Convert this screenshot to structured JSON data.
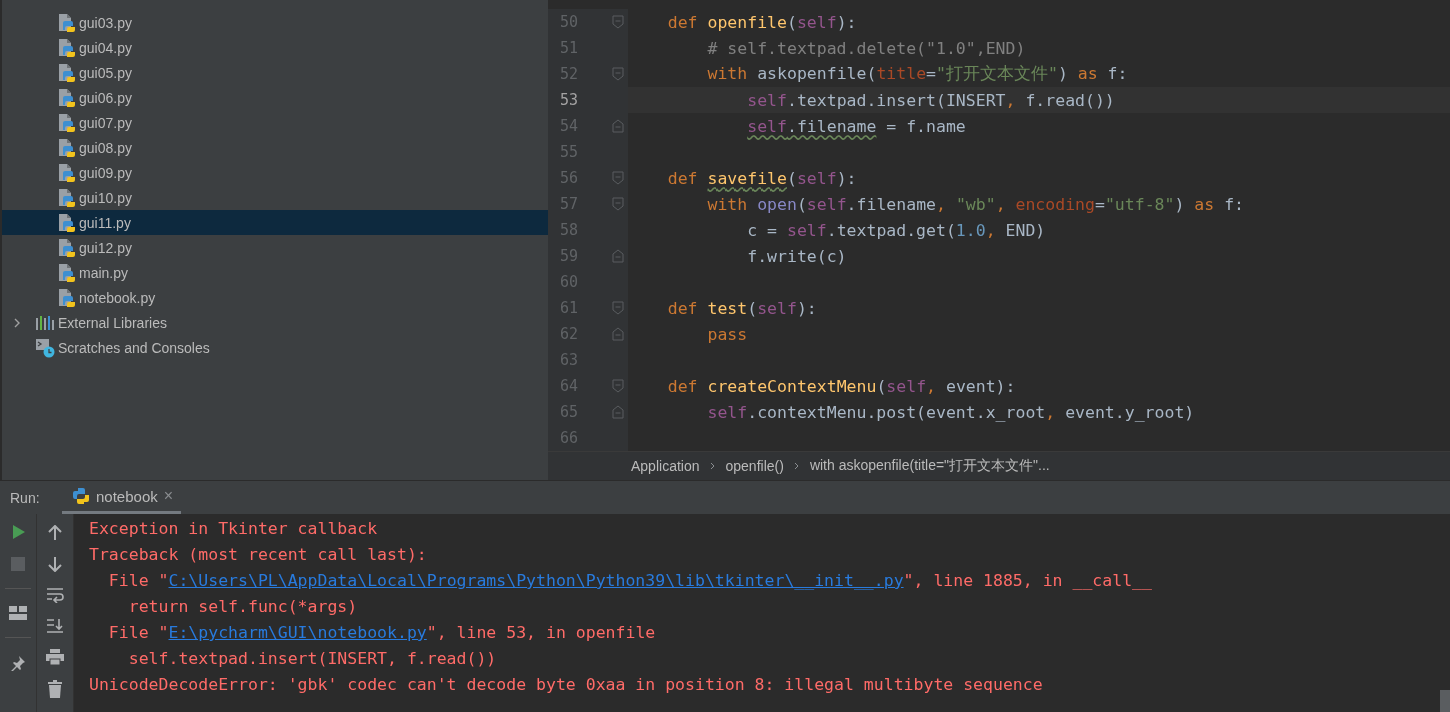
{
  "project_tree": {
    "items": [
      {
        "kind": "file",
        "label": "gui03.py",
        "selected": false
      },
      {
        "kind": "file",
        "label": "gui04.py",
        "selected": false
      },
      {
        "kind": "file",
        "label": "gui05.py",
        "selected": false
      },
      {
        "kind": "file",
        "label": "gui06.py",
        "selected": false
      },
      {
        "kind": "file",
        "label": "gui07.py",
        "selected": false
      },
      {
        "kind": "file",
        "label": "gui08.py",
        "selected": false
      },
      {
        "kind": "file",
        "label": "gui09.py",
        "selected": false
      },
      {
        "kind": "file",
        "label": "gui10.py",
        "selected": false
      },
      {
        "kind": "file",
        "label": "gui11.py",
        "selected": true
      },
      {
        "kind": "file",
        "label": "gui12.py",
        "selected": false
      },
      {
        "kind": "file",
        "label": "main.py",
        "selected": false
      },
      {
        "kind": "file",
        "label": "notebook.py",
        "selected": false
      },
      {
        "kind": "library",
        "label": "External Libraries",
        "selected": false,
        "expanded": false
      },
      {
        "kind": "scratches",
        "label": "Scratches and Consoles",
        "selected": false
      }
    ]
  },
  "editor": {
    "lines": [
      {
        "number": "50",
        "current": false,
        "fold_start": true,
        "fold_end": false,
        "tokens": [
          {
            "kind": "keyword",
            "text": "    def "
          },
          {
            "kind": "function",
            "text": "openfile"
          },
          {
            "kind": "plain",
            "text": "("
          },
          {
            "kind": "self",
            "text": "self"
          },
          {
            "kind": "plain",
            "text": "):"
          }
        ]
      },
      {
        "number": "51",
        "current": false,
        "fold_start": false,
        "fold_end": false,
        "tokens": [
          {
            "kind": "comment",
            "text": "        # self.textpad.delete(\"1.0\",END)"
          }
        ]
      },
      {
        "number": "52",
        "current": false,
        "fold_start": true,
        "fold_end": false,
        "tokens": [
          {
            "kind": "keyword",
            "text": "        with"
          },
          {
            "kind": "plain",
            "text": " askopenfile("
          },
          {
            "kind": "param",
            "text": "title"
          },
          {
            "kind": "plain",
            "text": "="
          },
          {
            "kind": "string",
            "text": "\"打开文本文件\""
          },
          {
            "kind": "plain",
            "text": ") "
          },
          {
            "kind": "keyword",
            "text": "as"
          },
          {
            "kind": "plain",
            "text": " f:"
          }
        ]
      },
      {
        "number": "53",
        "current": true,
        "fold_start": false,
        "fold_end": false,
        "tokens": [
          {
            "kind": "self",
            "text": "            self"
          },
          {
            "kind": "plain",
            "text": ".textpad.insert(INSERT"
          },
          {
            "kind": "keyword",
            "text": ", "
          },
          {
            "kind": "plain",
            "text": "f.read())"
          }
        ]
      },
      {
        "number": "54",
        "current": false,
        "fold_start": false,
        "fold_end": true,
        "tokens": [
          {
            "kind": "self",
            "text": "            self",
            "warning": true
          },
          {
            "kind": "plain",
            "text": ".filename",
            "warning": true
          },
          {
            "kind": "plain",
            "text": " = f.name"
          }
        ]
      },
      {
        "number": "55",
        "current": false,
        "fold_start": false,
        "fold_end": false
      },
      {
        "number": "56",
        "current": false,
        "fold_start": true,
        "fold_end": false,
        "tokens": [
          {
            "kind": "keyword",
            "text": "    def "
          },
          {
            "kind": "function",
            "text": "savefile",
            "warning": true
          },
          {
            "kind": "plain",
            "text": "("
          },
          {
            "kind": "self",
            "text": "self"
          },
          {
            "kind": "plain",
            "text": "):"
          }
        ]
      },
      {
        "number": "57",
        "current": false,
        "fold_start": true,
        "fold_end": false,
        "tokens": [
          {
            "kind": "keyword",
            "text": "        with "
          },
          {
            "kind": "builtin",
            "text": "open"
          },
          {
            "kind": "plain",
            "text": "("
          },
          {
            "kind": "self",
            "text": "self"
          },
          {
            "kind": "plain",
            "text": ".filename"
          },
          {
            "kind": "keyword",
            "text": ", "
          },
          {
            "kind": "string",
            "text": "\"wb\""
          },
          {
            "kind": "keyword",
            "text": ", "
          },
          {
            "kind": "param",
            "text": "encoding"
          },
          {
            "kind": "plain",
            "text": "="
          },
          {
            "kind": "string",
            "text": "\"utf-8\""
          },
          {
            "kind": "plain",
            "text": ") "
          },
          {
            "kind": "keyword",
            "text": "as"
          },
          {
            "kind": "plain",
            "text": " f:"
          }
        ]
      },
      {
        "number": "58",
        "current": false,
        "fold_start": false,
        "fold_end": false,
        "tokens": [
          {
            "kind": "plain",
            "text": "            c = "
          },
          {
            "kind": "self",
            "text": "self"
          },
          {
            "kind": "plain",
            "text": ".textpad.get("
          },
          {
            "kind": "number",
            "text": "1.0"
          },
          {
            "kind": "keyword",
            "text": ", "
          },
          {
            "kind": "plain",
            "text": "END)"
          }
        ]
      },
      {
        "number": "59",
        "current": false,
        "fold_start": false,
        "fold_end": true,
        "tokens": [
          {
            "kind": "plain",
            "text": "            f.write(c)"
          }
        ]
      },
      {
        "number": "60",
        "current": false,
        "fold_start": false,
        "fold_end": false
      },
      {
        "number": "61",
        "current": false,
        "fold_start": true,
        "fold_end": false,
        "tokens": [
          {
            "kind": "keyword",
            "text": "    def "
          },
          {
            "kind": "function",
            "text": "test"
          },
          {
            "kind": "plain",
            "text": "("
          },
          {
            "kind": "self",
            "text": "self"
          },
          {
            "kind": "plain",
            "text": "):"
          }
        ]
      },
      {
        "number": "62",
        "current": false,
        "fold_start": false,
        "fold_end": true,
        "tokens": [
          {
            "kind": "keyword",
            "text": "        pass"
          }
        ]
      },
      {
        "number": "63",
        "current": false,
        "fold_start": false,
        "fold_end": false
      },
      {
        "number": "64",
        "current": false,
        "fold_start": true,
        "fold_end": false,
        "tokens": [
          {
            "kind": "keyword",
            "text": "    def "
          },
          {
            "kind": "function",
            "text": "createContextMenu"
          },
          {
            "kind": "plain",
            "text": "("
          },
          {
            "kind": "self",
            "text": "self"
          },
          {
            "kind": "keyword",
            "text": ", "
          },
          {
            "kind": "plain",
            "text": "event):"
          }
        ]
      },
      {
        "number": "65",
        "current": false,
        "fold_start": false,
        "fold_end": true,
        "tokens": [
          {
            "kind": "self",
            "text": "        self"
          },
          {
            "kind": "plain",
            "text": ".contextMenu.post(event.x_root"
          },
          {
            "kind": "keyword",
            "text": ", "
          },
          {
            "kind": "plain",
            "text": "event.y_root)"
          }
        ]
      },
      {
        "number": "66",
        "current": false,
        "fold_start": false,
        "fold_end": false
      }
    ],
    "breadcrumbs": [
      "Application",
      "openfile()",
      "with askopenfile(title=\"打开文本文件\"..."
    ]
  },
  "run_panel": {
    "label": "Run:",
    "tabs": [
      {
        "label": "notebook",
        "close": "×",
        "selected": true
      }
    ],
    "console": [
      [
        {
          "text": "Exception in Tkinter callback"
        }
      ],
      [
        {
          "text": "Traceback (most recent call last):"
        }
      ],
      [
        {
          "text": "  File \""
        },
        {
          "text": "C:\\Users\\PL\\AppData\\Local\\Programs\\Python\\Python39\\lib\\tkinter\\__init__.py",
          "link": true
        },
        {
          "text": "\", line 1885, in __call__"
        }
      ],
      [
        {
          "text": "    return self.func(*args)"
        }
      ],
      [
        {
          "text": "  File \""
        },
        {
          "text": "E:\\pycharm\\GUI\\notebook.py",
          "link": true
        },
        {
          "text": "\", line 53, in openfile"
        }
      ],
      [
        {
          "text": "    self.textpad.insert(INSERT, f.read())"
        }
      ],
      [
        {
          "text": "UnicodeDecodeError: 'gbk' codec can't decode byte 0xaa in position 8: illegal multibyte sequence"
        }
      ]
    ]
  }
}
